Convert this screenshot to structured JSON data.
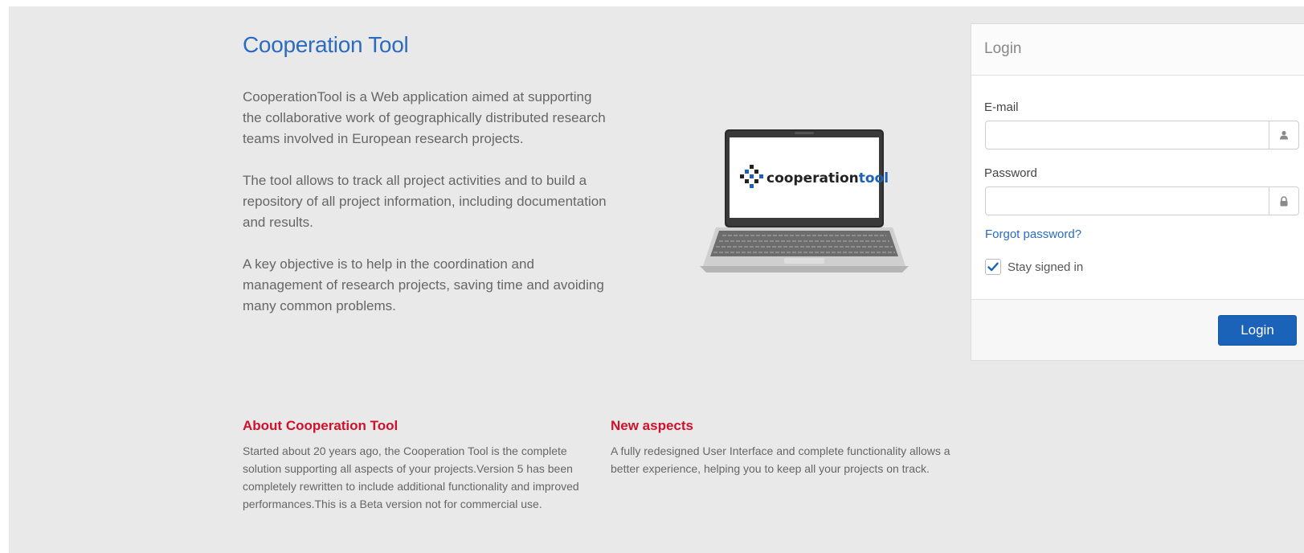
{
  "header": {
    "title": "Cooperation Tool"
  },
  "intro": {
    "paragraphs": [
      "CooperationTool is a Web application aimed at supporting the collaborative work of geographically distributed research teams involved in European research projects.",
      "The tool allows to track all project activities and to build a repository of all project information, including documentation and results.",
      "A key objective is to help in the coordination and management of research projects, saving time and avoiding many common problems."
    ]
  },
  "laptop_image": {
    "logo_text_dark": "cooperation",
    "logo_text_accent": "tool",
    "accent_color": "#1b63b9"
  },
  "about": {
    "heading": "About Cooperation Tool",
    "text": "Started about 20 years ago, the Cooperation Tool is the complete solution supporting all aspects of your projects.Version 5 has been completely rewritten to include additional functionality and improved performances.This is a Beta version not for commercial use."
  },
  "new_aspects": {
    "heading": "New aspects",
    "text": "A fully redesigned User Interface and complete functionality allows a better experience, helping you to keep all your projects on track."
  },
  "login": {
    "card_title": "Login",
    "email_label": "E-mail",
    "email_value": "",
    "email_icon": "user-icon",
    "password_label": "Password",
    "password_value": "",
    "password_icon": "lock-icon",
    "forgot_label": "Forgot password?",
    "stay_signed_in_label": "Stay signed in",
    "stay_signed_in_checked": true,
    "submit_label": "Login"
  },
  "colors": {
    "title_blue": "#2b6cbf",
    "heading_red": "#d0112b",
    "button_blue": "#1b63b9",
    "background": "#e9e9e9"
  }
}
